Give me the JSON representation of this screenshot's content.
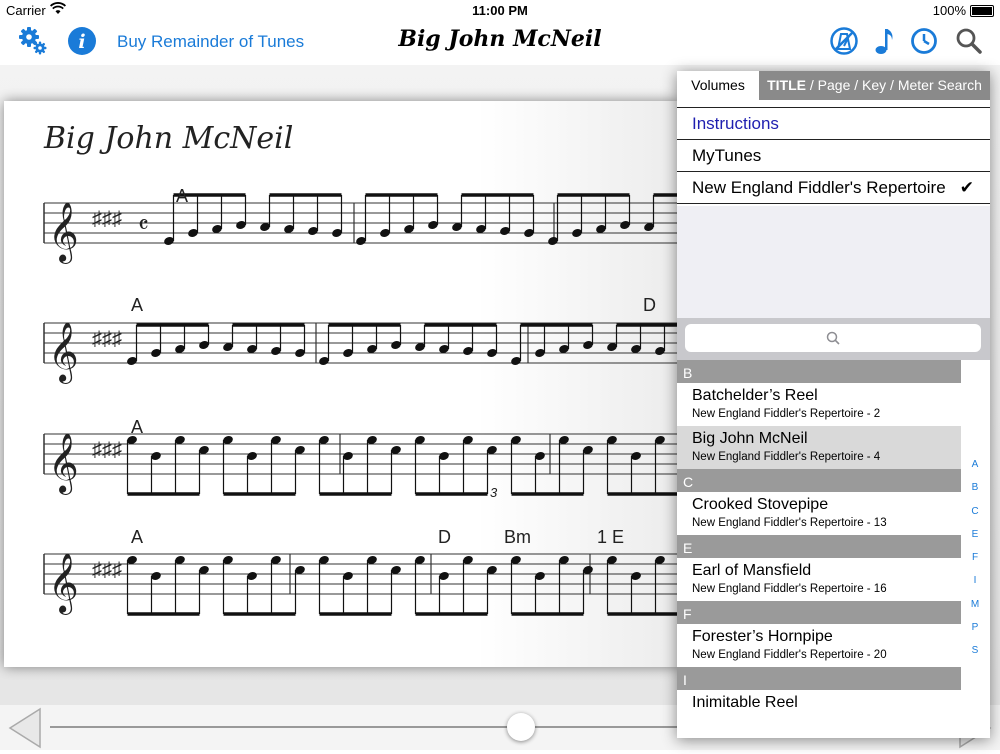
{
  "status_bar": {
    "carrier": "Carrier",
    "time": "11:00 PM",
    "battery": "100%"
  },
  "toolbar": {
    "title": "Big John McNeil",
    "buy_link": "Buy Remainder of Tunes",
    "icons": [
      "settings-gear-icon",
      "info-icon",
      "metronome-off-icon",
      "music-note-icon",
      "clock-icon",
      "search-icon"
    ],
    "accent_color": "#1a7bd8"
  },
  "sheet": {
    "title": "Big John McNeil",
    "chords": [
      "A",
      "A",
      "D",
      "A",
      "A",
      "D",
      "Bm",
      "1 E"
    ],
    "tuplet": "3"
  },
  "popover": {
    "tab_volumes": "Volumes",
    "tab_search_bold": "TITLE",
    "tab_search_rest": " / Page / Key / Meter Search",
    "volumes": [
      {
        "label": "Instructions"
      },
      {
        "label": "MyTunes"
      },
      {
        "label": "New England Fiddler's Repertoire",
        "checked": "✔"
      }
    ],
    "sections": [
      {
        "letter": "B",
        "tunes": [
          {
            "name": "Batchelder’s Reel",
            "sub": "New England Fiddler's Repertoire - 2"
          },
          {
            "name": "Big John McNeil",
            "sub": "New England Fiddler's Repertoire - 4",
            "selected": true
          }
        ]
      },
      {
        "letter": "C",
        "tunes": [
          {
            "name": "Crooked Stovepipe",
            "sub": "New England Fiddler's Repertoire - 13"
          }
        ]
      },
      {
        "letter": "E",
        "tunes": [
          {
            "name": "Earl of Mansfield",
            "sub": "New England Fiddler's Repertoire - 16"
          }
        ]
      },
      {
        "letter": "F",
        "tunes": [
          {
            "name": "Forester’s Hornpipe",
            "sub": "New England Fiddler's Repertoire - 20"
          }
        ]
      },
      {
        "letter": "I",
        "tunes": [
          {
            "name": "Inimitable Reel",
            "sub": ""
          }
        ]
      }
    ],
    "index_letters": [
      "A",
      "B",
      "C",
      "E",
      "F",
      "I",
      "M",
      "P",
      "S"
    ]
  },
  "bottom_bar": {
    "slider_value": 0.52
  }
}
